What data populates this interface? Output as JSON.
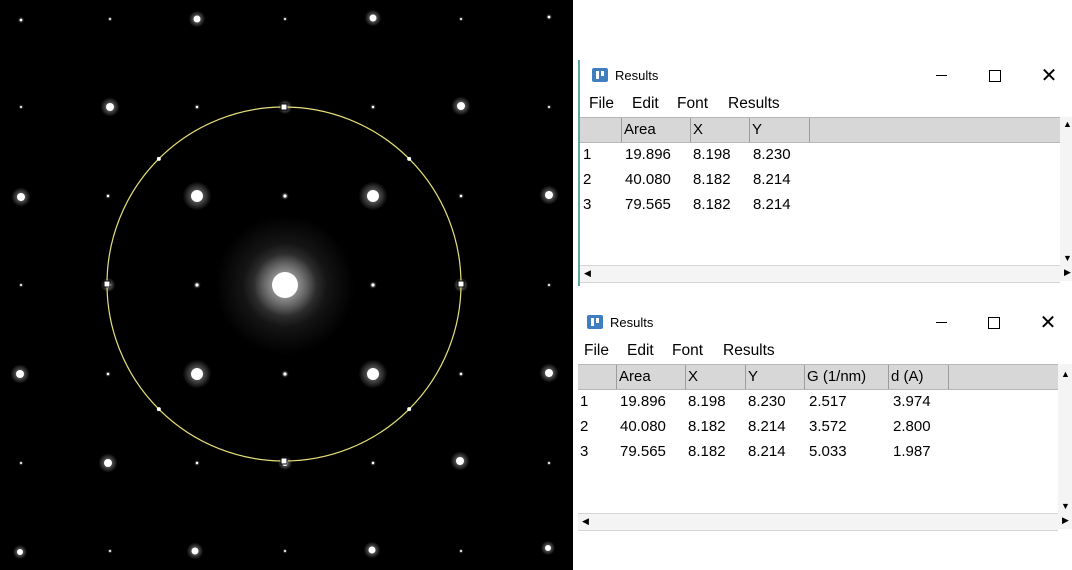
{
  "window1": {
    "title": "Results",
    "menu": [
      "File",
      "Edit",
      "Font",
      "Results"
    ],
    "columns": [
      "",
      "Area",
      "X",
      "Y"
    ],
    "rows": [
      [
        "1",
        "19.896",
        "8.198",
        "8.230"
      ],
      [
        "2",
        "40.080",
        "8.182",
        "8.214"
      ],
      [
        "3",
        "79.565",
        "8.182",
        "8.214"
      ]
    ]
  },
  "window2": {
    "title": "Results",
    "menu": [
      "File",
      "Edit",
      "Font",
      "Results"
    ],
    "columns": [
      "",
      "Area",
      "X",
      "Y",
      "G (1/nm)",
      "d (A)"
    ],
    "rows": [
      [
        "1",
        "19.896",
        "8.198",
        "8.230",
        "2.517",
        "3.974"
      ],
      [
        "2",
        "40.080",
        "8.182",
        "8.214",
        "3.572",
        "2.800"
      ],
      [
        "3",
        "79.565",
        "8.182",
        "8.214",
        "5.033",
        "1.987"
      ]
    ]
  },
  "icons": {
    "app": "imagej-results-icon",
    "minimize": "minimize-icon",
    "maximize": "maximize-icon",
    "close": "close-icon"
  },
  "colors": {
    "selection_circle": "#e6e07a",
    "image_background": "#000000",
    "window_accent": "#5aa8a0"
  }
}
